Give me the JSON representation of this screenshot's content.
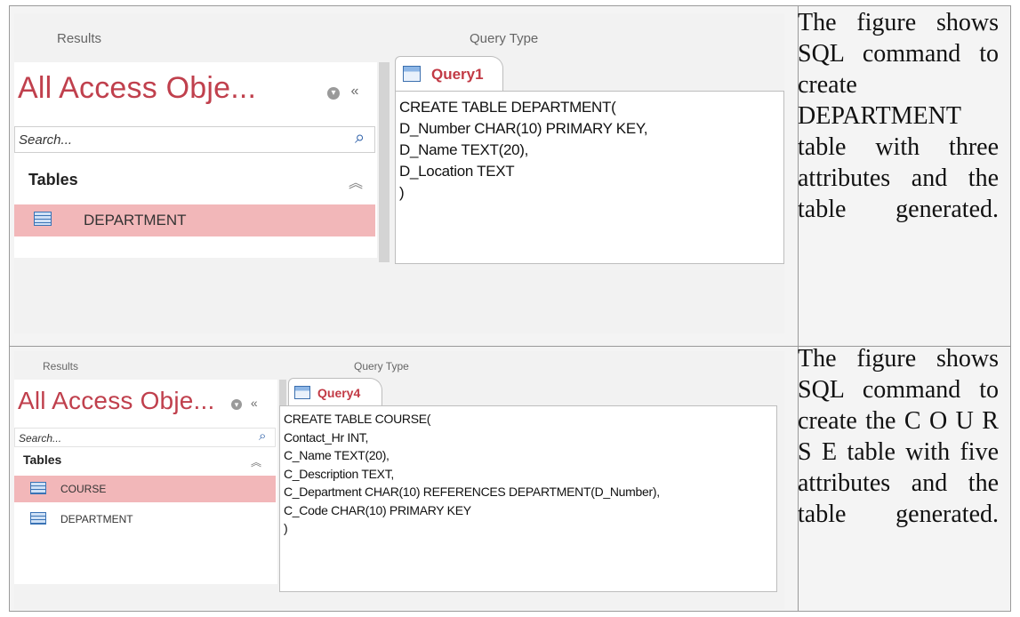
{
  "panels": [
    {
      "header": {
        "results": "Results",
        "query_type": "Query Type"
      },
      "nav": {
        "title": "All Access Obje...",
        "search_placeholder": "Search...",
        "group": "Tables",
        "tables": [
          "DEPARTMENT"
        ],
        "selected": "DEPARTMENT"
      },
      "query": {
        "tab": "Query1",
        "sql": "CREATE TABLE DEPARTMENT(\nD_Number CHAR(10) PRIMARY KEY,\nD_Name TEXT(20),\nD_Location TEXT\n)"
      },
      "description": "The figure shows SQL command to create DEPARTMENT table with three attributes and the table generated."
    },
    {
      "header": {
        "results": "Results",
        "query_type": "Query Type"
      },
      "nav": {
        "title": "All Access Obje...",
        "search_placeholder": "Search...",
        "group": "Tables",
        "tables": [
          "COURSE",
          "DEPARTMENT"
        ],
        "selected": "COURSE"
      },
      "query": {
        "tab": "Query4",
        "sql": "CREATE TABLE COURSE(\nContact_Hr INT,\nC_Name TEXT(20),\nC_Description TEXT,\nC_Department CHAR(10) REFERENCES DEPARTMENT(D_Number),\nC_Code CHAR(10) PRIMARY KEY\n)"
      },
      "description": "The figure shows SQL command to create the C O U R S E table with five attributes and the table generated."
    }
  ],
  "icons": {
    "search": "magnifier-icon",
    "table": "table-icon",
    "query": "query-icon",
    "collapse": "collapse-icon"
  },
  "colors": {
    "accent": "#c0404d",
    "selected_bg": "#f2b7b9"
  }
}
